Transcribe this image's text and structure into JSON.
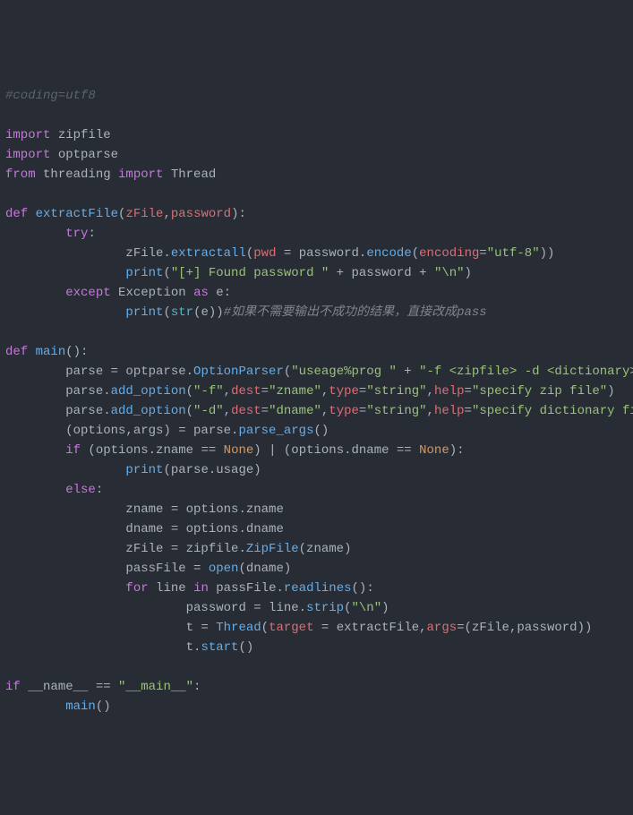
{
  "lines": [
    [
      {
        "cls": "comment",
        "text": "#coding=utf8"
      }
    ],
    [],
    [
      {
        "cls": "keyword",
        "text": "import"
      },
      {
        "cls": "ident",
        "text": " zipfile"
      }
    ],
    [
      {
        "cls": "keyword",
        "text": "import"
      },
      {
        "cls": "ident",
        "text": " optparse"
      }
    ],
    [
      {
        "cls": "keyword",
        "text": "from"
      },
      {
        "cls": "ident",
        "text": " threading "
      },
      {
        "cls": "keyword",
        "text": "import"
      },
      {
        "cls": "ident",
        "text": " Thread"
      }
    ],
    [],
    [
      {
        "cls": "keyword",
        "text": "def"
      },
      {
        "cls": "ident",
        "text": " "
      },
      {
        "cls": "funcname",
        "text": "extractFile"
      },
      {
        "cls": "punct",
        "text": "("
      },
      {
        "cls": "paramname",
        "text": "zFile"
      },
      {
        "cls": "punct",
        "text": ","
      },
      {
        "cls": "paramname",
        "text": "password"
      },
      {
        "cls": "punct",
        "text": "):"
      }
    ],
    [
      {
        "cls": "ident",
        "text": "        "
      },
      {
        "cls": "keyword",
        "text": "try"
      },
      {
        "cls": "punct",
        "text": ":"
      }
    ],
    [
      {
        "cls": "ident",
        "text": "                zFile."
      },
      {
        "cls": "funccall",
        "text": "extractall"
      },
      {
        "cls": "punct",
        "text": "("
      },
      {
        "cls": "paramname",
        "text": "pwd"
      },
      {
        "cls": "punct",
        "text": " = "
      },
      {
        "cls": "ident",
        "text": "password."
      },
      {
        "cls": "funccall",
        "text": "encode"
      },
      {
        "cls": "punct",
        "text": "("
      },
      {
        "cls": "paramname",
        "text": "encoding"
      },
      {
        "cls": "punct",
        "text": "="
      },
      {
        "cls": "string",
        "text": "\"utf-8\""
      },
      {
        "cls": "punct",
        "text": "))"
      }
    ],
    [
      {
        "cls": "ident",
        "text": "                "
      },
      {
        "cls": "funccall",
        "text": "print"
      },
      {
        "cls": "punct",
        "text": "("
      },
      {
        "cls": "string",
        "text": "\"[+] Found password \""
      },
      {
        "cls": "punct",
        "text": " + "
      },
      {
        "cls": "ident",
        "text": "password"
      },
      {
        "cls": "punct",
        "text": " + "
      },
      {
        "cls": "string",
        "text": "\"\\n\""
      },
      {
        "cls": "punct",
        "text": ")"
      }
    ],
    [
      {
        "cls": "ident",
        "text": "        "
      },
      {
        "cls": "keyword",
        "text": "except"
      },
      {
        "cls": "ident",
        "text": " Exception "
      },
      {
        "cls": "keyword",
        "text": "as"
      },
      {
        "cls": "ident",
        "text": " e:"
      }
    ],
    [
      {
        "cls": "ident",
        "text": "                "
      },
      {
        "cls": "funccall",
        "text": "print"
      },
      {
        "cls": "punct",
        "text": "("
      },
      {
        "cls": "builtin",
        "text": "str"
      },
      {
        "cls": "punct",
        "text": "(e))"
      },
      {
        "cls": "comment-cn",
        "text": "#如果不需要输出不成功的结果，直接改成pass"
      }
    ],
    [],
    [
      {
        "cls": "keyword",
        "text": "def"
      },
      {
        "cls": "ident",
        "text": " "
      },
      {
        "cls": "funcname",
        "text": "main"
      },
      {
        "cls": "punct",
        "text": "():"
      }
    ],
    [
      {
        "cls": "ident",
        "text": "        parse = optparse."
      },
      {
        "cls": "funccall",
        "text": "OptionParser"
      },
      {
        "cls": "punct",
        "text": "("
      },
      {
        "cls": "string",
        "text": "\"useage%prog \""
      },
      {
        "cls": "punct",
        "text": " + "
      },
      {
        "cls": "string",
        "text": "\"-f <zipfile> -d <dictionary>\""
      },
      {
        "cls": "punct",
        "text": ")"
      }
    ],
    [
      {
        "cls": "ident",
        "text": "        parse."
      },
      {
        "cls": "funccall",
        "text": "add_option"
      },
      {
        "cls": "punct",
        "text": "("
      },
      {
        "cls": "string",
        "text": "\"-f\""
      },
      {
        "cls": "punct",
        "text": ","
      },
      {
        "cls": "paramname",
        "text": "dest"
      },
      {
        "cls": "punct",
        "text": "="
      },
      {
        "cls": "string",
        "text": "\"zname\""
      },
      {
        "cls": "punct",
        "text": ","
      },
      {
        "cls": "paramname",
        "text": "type"
      },
      {
        "cls": "punct",
        "text": "="
      },
      {
        "cls": "string",
        "text": "\"string\""
      },
      {
        "cls": "punct",
        "text": ","
      },
      {
        "cls": "paramname",
        "text": "help"
      },
      {
        "cls": "punct",
        "text": "="
      },
      {
        "cls": "string",
        "text": "\"specify zip file\""
      },
      {
        "cls": "punct",
        "text": ")"
      }
    ],
    [
      {
        "cls": "ident",
        "text": "        parse."
      },
      {
        "cls": "funccall",
        "text": "add_option"
      },
      {
        "cls": "punct",
        "text": "("
      },
      {
        "cls": "string",
        "text": "\"-d\""
      },
      {
        "cls": "punct",
        "text": ","
      },
      {
        "cls": "paramname",
        "text": "dest"
      },
      {
        "cls": "punct",
        "text": "="
      },
      {
        "cls": "string",
        "text": "\"dname\""
      },
      {
        "cls": "punct",
        "text": ","
      },
      {
        "cls": "paramname",
        "text": "type"
      },
      {
        "cls": "punct",
        "text": "="
      },
      {
        "cls": "string",
        "text": "\"string\""
      },
      {
        "cls": "punct",
        "text": ","
      },
      {
        "cls": "paramname",
        "text": "help"
      },
      {
        "cls": "punct",
        "text": "="
      },
      {
        "cls": "string",
        "text": "\"specify dictionary file\""
      },
      {
        "cls": "punct",
        "text": ")"
      }
    ],
    [
      {
        "cls": "ident",
        "text": "        (options,args) = parse."
      },
      {
        "cls": "funccall",
        "text": "parse_args"
      },
      {
        "cls": "punct",
        "text": "()"
      }
    ],
    [
      {
        "cls": "ident",
        "text": "        "
      },
      {
        "cls": "keyword",
        "text": "if"
      },
      {
        "cls": "ident",
        "text": " (options.zname == "
      },
      {
        "cls": "const",
        "text": "None"
      },
      {
        "cls": "ident",
        "text": ") | (options.dname == "
      },
      {
        "cls": "const",
        "text": "None"
      },
      {
        "cls": "ident",
        "text": "):"
      }
    ],
    [
      {
        "cls": "ident",
        "text": "                "
      },
      {
        "cls": "funccall",
        "text": "print"
      },
      {
        "cls": "punct",
        "text": "(parse.usage)"
      }
    ],
    [
      {
        "cls": "ident",
        "text": "        "
      },
      {
        "cls": "keyword",
        "text": "else"
      },
      {
        "cls": "punct",
        "text": ":"
      }
    ],
    [
      {
        "cls": "ident",
        "text": "                zname = options.zname"
      }
    ],
    [
      {
        "cls": "ident",
        "text": "                dname = options.dname"
      }
    ],
    [
      {
        "cls": "ident",
        "text": "                zFile = zipfile."
      },
      {
        "cls": "funccall",
        "text": "ZipFile"
      },
      {
        "cls": "punct",
        "text": "(zname)"
      }
    ],
    [
      {
        "cls": "ident",
        "text": "                passFile = "
      },
      {
        "cls": "funccall",
        "text": "open"
      },
      {
        "cls": "punct",
        "text": "(dname)"
      }
    ],
    [
      {
        "cls": "ident",
        "text": "                "
      },
      {
        "cls": "keyword",
        "text": "for"
      },
      {
        "cls": "ident",
        "text": " line "
      },
      {
        "cls": "keyword",
        "text": "in"
      },
      {
        "cls": "ident",
        "text": " passFile."
      },
      {
        "cls": "funccall",
        "text": "readlines"
      },
      {
        "cls": "punct",
        "text": "():"
      }
    ],
    [
      {
        "cls": "ident",
        "text": "                        password = line."
      },
      {
        "cls": "funccall",
        "text": "strip"
      },
      {
        "cls": "punct",
        "text": "("
      },
      {
        "cls": "string",
        "text": "\"\\n\""
      },
      {
        "cls": "punct",
        "text": ")"
      }
    ],
    [
      {
        "cls": "ident",
        "text": "                        t = "
      },
      {
        "cls": "funccall",
        "text": "Thread"
      },
      {
        "cls": "punct",
        "text": "("
      },
      {
        "cls": "paramname",
        "text": "target"
      },
      {
        "cls": "punct",
        "text": " = extractFile,"
      },
      {
        "cls": "paramname",
        "text": "args"
      },
      {
        "cls": "punct",
        "text": "=(zFile,password))"
      }
    ],
    [
      {
        "cls": "ident",
        "text": "                        t."
      },
      {
        "cls": "funccall",
        "text": "start"
      },
      {
        "cls": "punct",
        "text": "()"
      }
    ],
    [],
    [
      {
        "cls": "keyword",
        "text": "if"
      },
      {
        "cls": "ident",
        "text": " __name__ == "
      },
      {
        "cls": "string",
        "text": "\"__main__\""
      },
      {
        "cls": "punct",
        "text": ":"
      }
    ],
    [
      {
        "cls": "ident",
        "text": "        "
      },
      {
        "cls": "funccall",
        "text": "main"
      },
      {
        "cls": "punct",
        "text": "()"
      }
    ]
  ]
}
